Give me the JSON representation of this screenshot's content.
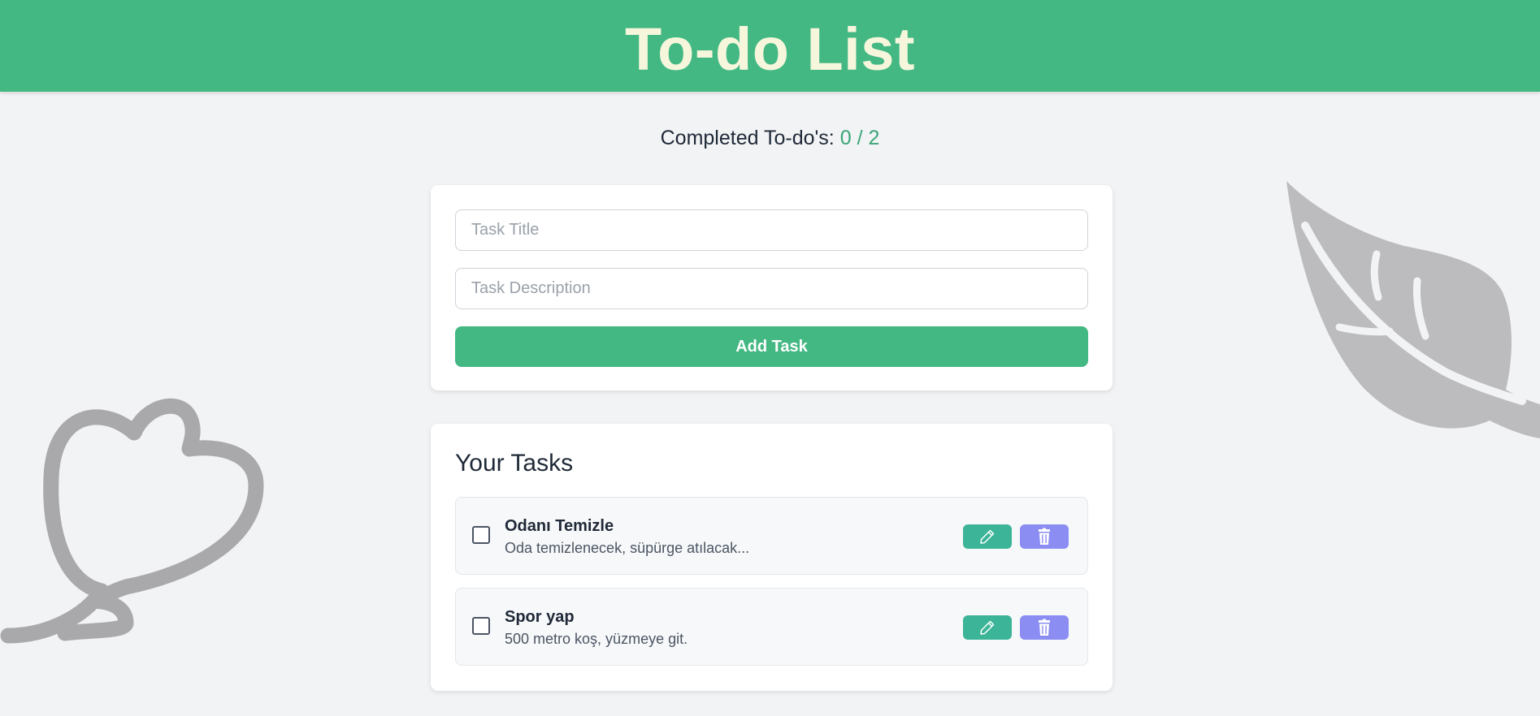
{
  "header": {
    "title": "To-do List"
  },
  "counter": {
    "label": "Completed To-do's:",
    "completed": 0,
    "total": 2,
    "display": "0 / 2"
  },
  "form": {
    "title_placeholder": "Task Title",
    "title_value": "",
    "description_placeholder": "Task Description",
    "description_value": "",
    "add_label": "Add Task"
  },
  "tasks_section": {
    "heading": "Your Tasks",
    "items": [
      {
        "title": "Odanı Temizle",
        "description": "Oda temizlenecek, süpürge atılacak...",
        "completed": false
      },
      {
        "title": "Spor yap",
        "description": "500 metro koş, yüzmeye git.",
        "completed": false
      }
    ]
  },
  "icons": {
    "edit": "pencil-icon",
    "delete": "trash-icon",
    "decor_left": "flower-doodle-icon",
    "decor_right": "leaf-icon"
  },
  "colors": {
    "header": "#43b883",
    "header_text": "#f6f6dc",
    "count": "#3aa577",
    "add_button": "#43b883",
    "edit_button": "#3bb497",
    "delete_button": "#8b8df2",
    "decoration": "#a9a9ab",
    "background": "#f2f3f5"
  }
}
